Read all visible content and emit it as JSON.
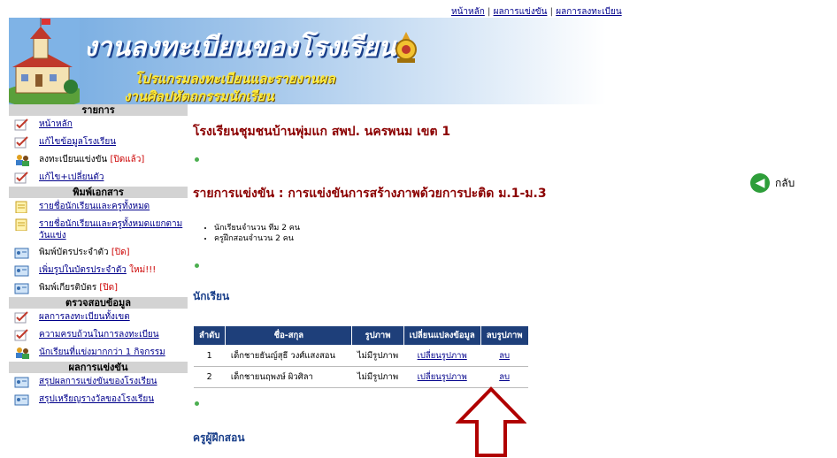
{
  "top_links": [
    {
      "label": "หน้าหลัก"
    },
    {
      "label": "ผลการแข่งขัน"
    },
    {
      "label": "ผลการลงทะเบียน"
    }
  ],
  "banner": {
    "title": "งานลงทะเบียนของโรงเรียน",
    "subtitle1": "โปรแกรมลงทะเบียนและรายงานผล",
    "subtitle2": "งานศิลปหัตถกรรมนักเรียน"
  },
  "sidebar": {
    "sections": [
      {
        "header": "รายการ",
        "items": [
          {
            "label": "หน้าหลัก",
            "link": true,
            "icon": "pencil-check-icon"
          },
          {
            "label": "แก้ไขข้อมูลโรงเรียน",
            "link": true,
            "icon": "pencil-check-icon"
          },
          {
            "label": "ลงทะเบียนแข่งขัน",
            "suffix": "[ปิดแล้ว]",
            "link": false,
            "icon": "users-icon"
          },
          {
            "label": "แก้ไข+เปลี่ยนตัว",
            "link": true,
            "icon": "pencil-check-icon"
          }
        ]
      },
      {
        "header": "พิมพ์เอกสาร",
        "items": [
          {
            "label": "รายชื่อนักเรียนและครูทั้งหมด",
            "link": true,
            "icon": "document-icon"
          },
          {
            "label": "รายชื่อนักเรียนและครูทั้งหมดแยกตามวันแข่ง",
            "link": true,
            "icon": "document-icon"
          },
          {
            "label": "พิมพ์บัตรประจำตัว",
            "suffix": "[ปิด]",
            "link": false,
            "icon": "card-icon"
          },
          {
            "label": "เพิ่มรูปในบัตรประจำตัว",
            "suffix": "ใหม่!!!",
            "link": true,
            "icon": "card-icon"
          },
          {
            "label": "พิมพ์เกียรติบัตร",
            "suffix": "[ปิด]",
            "link": false,
            "icon": "card-icon"
          }
        ]
      },
      {
        "header": "ตรวจสอบข้อมูล",
        "items": [
          {
            "label": "ผลการลงทะเบียนทั้งเขต",
            "link": true,
            "icon": "pencil-check-icon"
          },
          {
            "label": "ความครบถ้วนในการลงทะเบียน",
            "link": true,
            "icon": "pencil-check-icon"
          },
          {
            "label": "นักเรียนที่แข่งมากกว่า 1 กิจกรรม",
            "link": true,
            "icon": "users-icon"
          }
        ]
      },
      {
        "header": "ผลการแข่งขัน",
        "items": [
          {
            "label": "สรุปผลการแข่งขันของโรงเรียน",
            "link": true,
            "icon": "card-icon"
          },
          {
            "label": "สรุปเหรียญรางวัลของโรงเรียน",
            "link": true,
            "icon": "card-icon"
          }
        ]
      }
    ]
  },
  "main": {
    "school_title": "โรงเรียนชุมชนบ้านพุ่มแก สพป. นครพนม เขต 1",
    "competition_title": "รายการแข่งขัน : การแข่งขันการสร้างภาพด้วยการปะติด ม.1-ม.3",
    "summary": [
      "นักเรียนจำนวน ทีม 2 คน",
      "ครูฝึกสอนจำนวน 2 คน"
    ],
    "students_heading": "นักเรียน",
    "table": {
      "headers": [
        "ลำดับ",
        "ชื่อ-สกุล",
        "รูปภาพ",
        "เปลี่ยนแปลงข้อมูล",
        "ลบรูปภาพ"
      ],
      "rows": [
        {
          "no": "1",
          "name": "เด็กชายธันญ์สุธี   วงศ์แสงสอน",
          "photo": "ไม่มีรูปภาพ",
          "change": "เปลี่ยนรูปภาพ",
          "delete": "ลบ"
        },
        {
          "no": "2",
          "name": "เด็กชายนฤพงษ์   ผิวศิลา",
          "photo": "ไม่มีรูปภาพ",
          "change": "เปลี่ยนรูปภาพ",
          "delete": "ลบ"
        }
      ]
    },
    "teachers_heading": "ครูผู้ฝึกสอน",
    "back_label": "กลับ"
  },
  "colors": {
    "table_header": "#1e3f7a",
    "title_red": "#8b0000",
    "arrow": "#b00000"
  }
}
